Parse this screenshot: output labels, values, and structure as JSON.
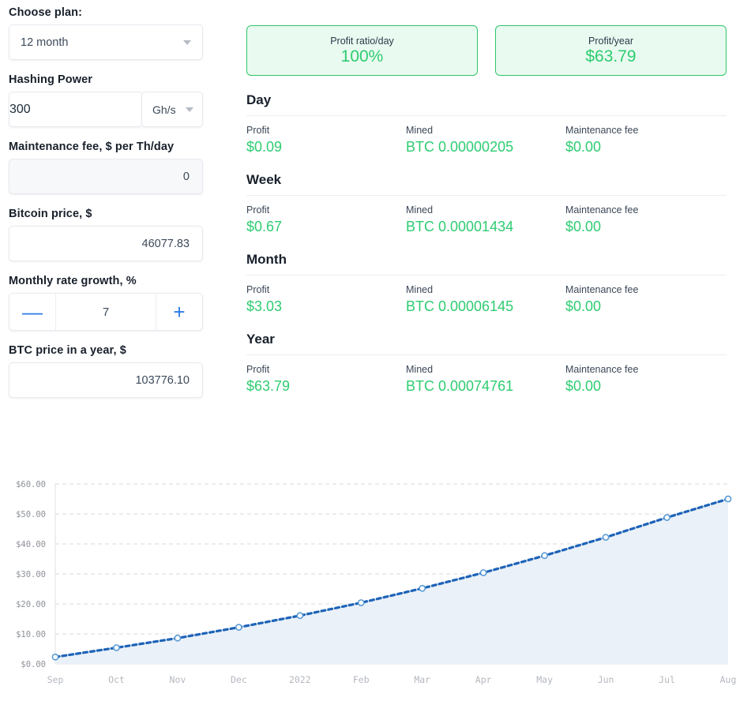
{
  "form": {
    "plan": {
      "label": "Choose plan:",
      "value": "12 month",
      "caret_icon": "chevron-down-icon"
    },
    "hashing_power": {
      "label": "Hashing Power",
      "value": "300",
      "unit": "Gh/s",
      "caret_icon": "chevron-down-icon"
    },
    "maintenance_fee": {
      "label": "Maintenance fee, $ per Th/day",
      "value": "0"
    },
    "bitcoin_price": {
      "label": "Bitcoin price, $",
      "value": "46077.83"
    },
    "monthly_rate_growth": {
      "label": "Monthly rate growth, %",
      "value": "7",
      "minus_label": "—",
      "plus_label": "+"
    },
    "btc_price_in_year": {
      "label": "BTC price in a year, $",
      "value": "103776.10"
    }
  },
  "summary_cards": [
    {
      "label": "Profit ratio/day",
      "value": "100%"
    },
    {
      "label": "Profit/year",
      "value": "$63.79"
    }
  ],
  "periods": [
    {
      "title": "Day",
      "metrics": [
        {
          "label": "Profit",
          "value": "$0.09"
        },
        {
          "label": "Mined",
          "value": "BTC 0.00000205"
        },
        {
          "label": "Maintenance fee",
          "value": "$0.00"
        }
      ]
    },
    {
      "title": "Week",
      "metrics": [
        {
          "label": "Profit",
          "value": "$0.67"
        },
        {
          "label": "Mined",
          "value": "BTC 0.00001434"
        },
        {
          "label": "Maintenance fee",
          "value": "$0.00"
        }
      ]
    },
    {
      "title": "Month",
      "metrics": [
        {
          "label": "Profit",
          "value": "$3.03"
        },
        {
          "label": "Mined",
          "value": "BTC 0.00006145"
        },
        {
          "label": "Maintenance fee",
          "value": "$0.00"
        }
      ]
    },
    {
      "title": "Year",
      "metrics": [
        {
          "label": "Profit",
          "value": "$63.79"
        },
        {
          "label": "Mined",
          "value": "BTC 0.00074761"
        },
        {
          "label": "Maintenance fee",
          "value": "$0.00"
        }
      ]
    }
  ],
  "colors": {
    "accent_green": "#2ecc71",
    "card_bg": "#e9faf0",
    "card_border": "#2fc66b",
    "accent_blue": "#2b7de9",
    "line_blue": "#1e63b8",
    "area_fill": "#eaf1f8"
  },
  "chart_data": {
    "type": "area",
    "title": "",
    "xlabel": "",
    "ylabel": "",
    "categories": [
      "Sep",
      "Oct",
      "Nov",
      "Dec",
      "2022",
      "Feb",
      "Mar",
      "Apr",
      "May",
      "Jun",
      "Jul",
      "Aug"
    ],
    "values": [
      2.3,
      5.4,
      8.6,
      12.2,
      16.1,
      20.4,
      25.2,
      30.4,
      36.1,
      42.2,
      48.8,
      55.0
    ],
    "ytick_labels": [
      "$60.00",
      "$50.00",
      "$40.00",
      "$30.00",
      "$20.00",
      "$10.00",
      "$0.00"
    ],
    "ytick_values": [
      60,
      50,
      40,
      30,
      20,
      10,
      0
    ],
    "ylim": [
      0,
      60
    ],
    "grid": true,
    "legend": "none",
    "line_style": "dotted",
    "marker": "open-circle"
  }
}
